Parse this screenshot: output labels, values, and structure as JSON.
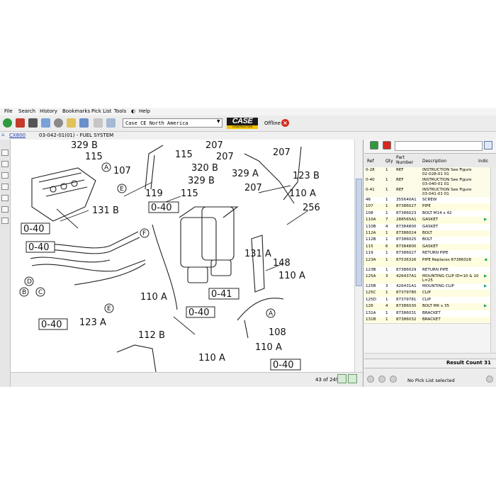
{
  "menu": [
    "File",
    "Search",
    "History",
    "Bookmarks",
    "Pick List",
    "Tools",
    "Help"
  ],
  "toolbar": {
    "region": "Case CE North America",
    "brand": "CASE",
    "brand_sub": "CONSTRUCTION",
    "status": "Offline"
  },
  "breadcrumb": {
    "model": "CX800",
    "title": "03-042-01(01) - FUEL SYSTEM"
  },
  "diagram_labels": {
    "l1": "329 B",
    "l2": "115",
    "l3": "A",
    "l4": "107",
    "l5": "E",
    "l6": "119",
    "l7": "0-40",
    "l8": "131 B",
    "l9": "0-40",
    "l10": "0-40",
    "l11": "D",
    "l12": "B",
    "l13": "C",
    "l14": "F",
    "l15": "E",
    "l16": "0-40",
    "l17": "123 A",
    "l18": "112 B",
    "l19": "110 A",
    "l20": "0-40",
    "l21": "115",
    "l22": "115",
    "l23": "207",
    "l24": "329 A",
    "l25": "207",
    "l26": "320 B",
    "l27": "207",
    "l28": "329 B",
    "l29": "123 B",
    "l30": "207",
    "l31": "110 A",
    "l32": "256",
    "l33": "0-41",
    "l34": "131 A",
    "l35": "148",
    "l36": "110 A",
    "l37": "A",
    "l38": "108",
    "l39": "110 A",
    "l40": "110 A",
    "l41": "0-40"
  },
  "pager": {
    "text": "43 of 249"
  },
  "parts_table": {
    "headers": {
      "ref": "Ref",
      "qty": "Qty",
      "pn": "Part Number",
      "desc": "Description",
      "ind": "Indic"
    },
    "rows": [
      {
        "ref": "0-28",
        "qty": "1",
        "pn": "REF",
        "desc": "INSTRUCTION See Figure 02-028-01 01",
        "ind": ""
      },
      {
        "ref": "0-40",
        "qty": "1",
        "pn": "REF",
        "desc": "INSTRUCTION See Figure 03-040-01 01",
        "ind": ""
      },
      {
        "ref": "0-41",
        "qty": "1",
        "pn": "REF",
        "desc": "INSTRUCTION See Figure 03-041-01 01",
        "ind": ""
      },
      {
        "ref": "46",
        "qty": "1",
        "pn": "355640A1",
        "desc": "SCREW",
        "ind": ""
      },
      {
        "ref": "107",
        "qty": "1",
        "pn": "87386027",
        "desc": "PIPE",
        "ind": ""
      },
      {
        "ref": "108",
        "qty": "1",
        "pn": "87386023",
        "desc": "BOLT M14 x 42",
        "ind": ""
      },
      {
        "ref": "110A",
        "qty": "7",
        "pn": "288565A1",
        "desc": "GASKET",
        "ind": "arrow"
      },
      {
        "ref": "110B",
        "qty": "4",
        "pn": "87384800",
        "desc": "GASKET",
        "ind": ""
      },
      {
        "ref": "112A",
        "qty": "1",
        "pn": "87386024",
        "desc": "BOLT",
        "ind": ""
      },
      {
        "ref": "112B",
        "qty": "1",
        "pn": "87386025",
        "desc": "BOLT",
        "ind": ""
      },
      {
        "ref": "115",
        "qty": "6",
        "pn": "87384800",
        "desc": "GASKET",
        "ind": ""
      },
      {
        "ref": "119",
        "qty": "1",
        "pn": "87386027",
        "desc": "RETURN PIPE",
        "ind": ""
      },
      {
        "ref": "123A",
        "qty": "1",
        "pn": "87536326",
        "desc": "PIPE Replaces 87386028",
        "ind": "arrow-left"
      },
      {
        "ref": "123B",
        "qty": "1",
        "pn": "87386029",
        "desc": "RETURN PIPE",
        "ind": ""
      },
      {
        "ref": "125A",
        "qty": "3",
        "pn": "426437A1",
        "desc": "MOUNTING CLIP ID=10 & 10 L=25",
        "ind": "arrow"
      },
      {
        "ref": "125B",
        "qty": "3",
        "pn": "426431A1",
        "desc": "MOUNTING CLIP",
        "ind": "arrow"
      },
      {
        "ref": "125C",
        "qty": "1",
        "pn": "87379780",
        "desc": "CLIP",
        "ind": ""
      },
      {
        "ref": "125D",
        "qty": "1",
        "pn": "87379781",
        "desc": "CLIP",
        "ind": ""
      },
      {
        "ref": "126",
        "qty": "4",
        "pn": "87386030",
        "desc": "BOLT M6 x 35",
        "ind": "arrow"
      },
      {
        "ref": "131A",
        "qty": "1",
        "pn": "87386031",
        "desc": "BRACKET",
        "ind": ""
      },
      {
        "ref": "131B",
        "qty": "1",
        "pn": "87386032",
        "desc": "BRACKET",
        "ind": ""
      }
    ]
  },
  "result": {
    "text": "Result Count 31"
  },
  "picklist": {
    "text": "No Pick List selected"
  },
  "colors": {
    "accent": "#1aa27a",
    "offline": "#d42a1e",
    "link": "#1a3fb0"
  }
}
